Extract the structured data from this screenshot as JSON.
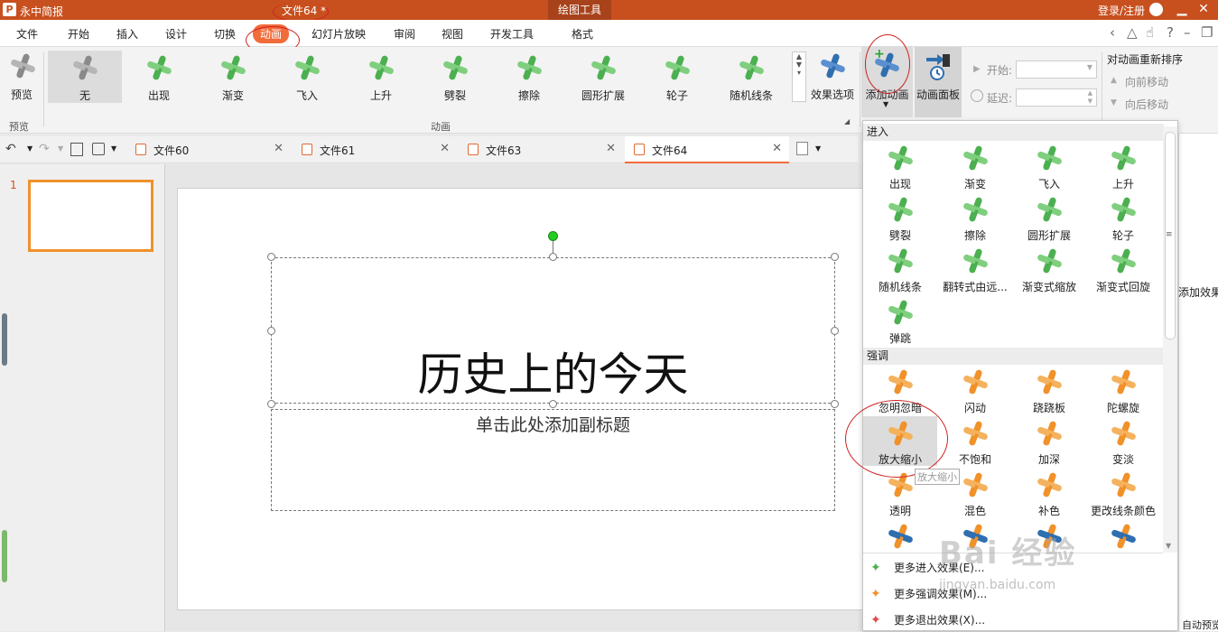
{
  "titlebar": {
    "app_name": "永中简报",
    "doc_title": "文件64 *",
    "tools_label": "绘图工具",
    "login": "登录/注册",
    "minimize": "▁",
    "close": "✕"
  },
  "menubar": {
    "items": [
      "文件",
      "开始",
      "插入",
      "设计",
      "切换",
      "动画",
      "幻灯片放映",
      "审阅",
      "视图",
      "开发工具",
      "格式"
    ],
    "active": "动画"
  },
  "ribbon": {
    "preview": {
      "label": "预览",
      "group": "预览"
    },
    "effects": [
      "无",
      "出现",
      "渐变",
      "飞入",
      "上升",
      "劈裂",
      "擦除",
      "圆形扩展",
      "轮子",
      "随机线条"
    ],
    "group_label": "动画",
    "effect_options": "效果选项",
    "add_animation": "添加动画",
    "animation_pane": "动画面板",
    "start_label": "开始:",
    "delay_label": "延迟:",
    "reorder_title": "对动画重新排序",
    "move_earlier": "向前移动",
    "move_later": "向后移动"
  },
  "tabs": [
    "文件60",
    "文件61",
    "文件63",
    "文件64"
  ],
  "slide": {
    "number": "1",
    "title": "历史上的今天",
    "subtitle": "单击此处添加副标题"
  },
  "dropdown": {
    "entrance_header": "进入",
    "entrance": [
      "出现",
      "渐变",
      "飞入",
      "上升",
      "劈裂",
      "擦除",
      "圆形扩展",
      "轮子",
      "随机线条",
      "翻转式由远...",
      "渐变式缩放",
      "渐变式回旋",
      "弹跳"
    ],
    "emphasis_header": "强调",
    "emphasis": [
      "忽明忽暗",
      "闪动",
      "跷跷板",
      "陀螺旋",
      "放大缩小",
      "不饱和",
      "加深",
      "变淡",
      "透明",
      "混色",
      "补色",
      "更改线条颜色"
    ],
    "tooltip": "放大缩小",
    "more_entrance": "更多进入效果(E)...",
    "more_emphasis": "更多强调效果(M)...",
    "more_exit": "更多退出效果(X)..."
  },
  "right_panel": {
    "add_effect": "添加效果",
    "auto_preview": "自动预览"
  },
  "watermark": {
    "brand": "Bai 经验",
    "url": "jingyan.baidu.com"
  },
  "colors": {
    "title_bar": "#c8501e",
    "accent": "#f26b3a",
    "entrance_icon": "#4caf50",
    "emphasis_icon": "#f0912a"
  }
}
